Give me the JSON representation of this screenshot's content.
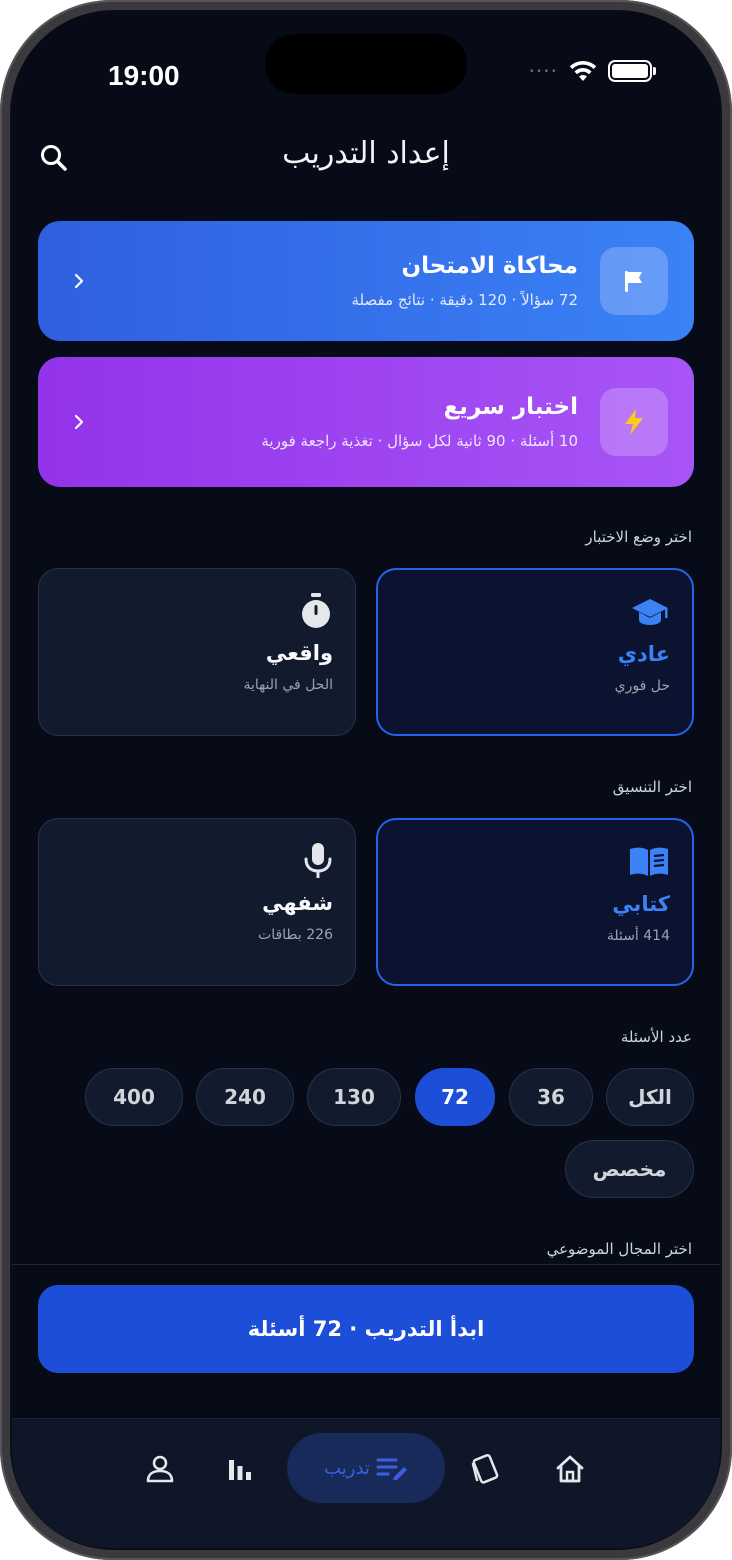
{
  "status": {
    "time": "19:00",
    "signal_dots": "····"
  },
  "header": {
    "title": "إعداد التدريب"
  },
  "exam_card": {
    "title": "محاكاة الامتحان",
    "subtitle": "72 سؤالاً · 120 دقيقة · نتائج مفصلة",
    "icon": "flag-icon"
  },
  "quick_card": {
    "title": "اختبار سريع",
    "subtitle": "10 أسئلة · 90 ثانية لكل سؤال · تغذية راجعة فورية",
    "icon": "lightning-icon"
  },
  "test_mode": {
    "label": "اختر وضع الاختبار",
    "options": [
      {
        "title": "عادي",
        "subtitle": "حل فوري",
        "icon": "graduation-cap-icon",
        "selected": true
      },
      {
        "title": "واقعي",
        "subtitle": "الحل في النهاية",
        "icon": "stopwatch-icon",
        "selected": false
      }
    ]
  },
  "format": {
    "label": "اختر التنسيق",
    "options": [
      {
        "title": "كتابي",
        "subtitle": "414 أسئلة",
        "icon": "book-icon",
        "selected": true
      },
      {
        "title": "شفهي",
        "subtitle": "226 بطاقات",
        "icon": "microphone-icon",
        "selected": false
      }
    ]
  },
  "question_count": {
    "label": "عدد الأسئلة",
    "chips": [
      "الكل",
      "36",
      "72",
      "130",
      "240",
      "400",
      "مخصص"
    ],
    "selected": "72"
  },
  "subject": {
    "label": "اختر المجال الموضوعي"
  },
  "start_button": {
    "label": "ابدأ التدريب · 72 أسئلة"
  },
  "tabbar": {
    "items": [
      {
        "icon": "home-icon"
      },
      {
        "icon": "flashcards-icon"
      },
      {
        "icon": "practice-icon",
        "label": "تدريب",
        "active": true
      },
      {
        "icon": "stats-icon"
      },
      {
        "icon": "profile-icon"
      }
    ]
  },
  "colors": {
    "accent": "#1d4ed8",
    "exam_gradient": "#3b82f6",
    "quick_gradient": "#a855f7",
    "background": "#060b17"
  }
}
